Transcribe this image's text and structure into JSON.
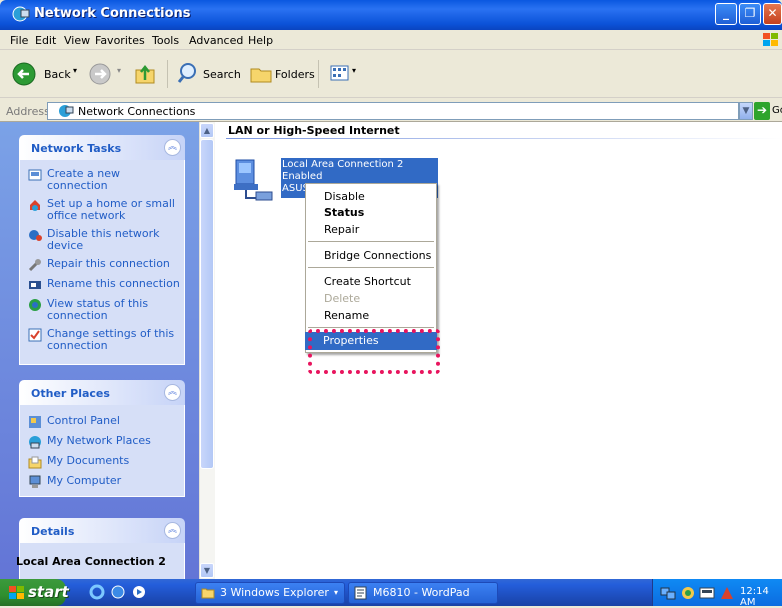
{
  "window": {
    "title": "Network Connections"
  },
  "menu": [
    "File",
    "Edit",
    "View",
    "Favorites",
    "Tools",
    "Advanced",
    "Help"
  ],
  "toolbar": {
    "back": "Back",
    "search": "Search",
    "folders": "Folders"
  },
  "address": {
    "label": "Address",
    "value": "Network Connections",
    "go": "Go"
  },
  "network_tasks": {
    "title": "Network Tasks",
    "items": [
      {
        "label": "Create a new connection",
        "icon": "new-connection-icon"
      },
      {
        "label": "Set up a home or small office network",
        "icon": "home-network-icon"
      },
      {
        "label": "Disable this network device",
        "icon": "disable-device-icon"
      },
      {
        "label": "Repair this connection",
        "icon": "repair-icon"
      },
      {
        "label": "Rename this connection",
        "icon": "rename-icon"
      },
      {
        "label": "View status of this connection",
        "icon": "status-icon"
      },
      {
        "label": "Change settings of this connection",
        "icon": "settings-icon"
      }
    ]
  },
  "other_places": {
    "title": "Other Places",
    "items": [
      {
        "label": "Control Panel",
        "icon": "control-panel-icon"
      },
      {
        "label": "My Network Places",
        "icon": "network-places-icon"
      },
      {
        "label": "My Documents",
        "icon": "documents-icon"
      },
      {
        "label": "My Computer",
        "icon": "computer-icon"
      }
    ]
  },
  "details": {
    "title": "Details",
    "name": "Local Area Connection 2"
  },
  "content": {
    "group": "LAN or High-Speed Internet",
    "connection": {
      "name": "Local Area Connection 2",
      "status": "Enabled",
      "device": "ASUS"
    }
  },
  "context_menu": {
    "disable": "Disable",
    "status": "Status",
    "repair": "Repair",
    "bridge": "Bridge Connections",
    "shortcut": "Create Shortcut",
    "delete": "Delete",
    "rename": "Rename",
    "properties": "Properties"
  },
  "taskbar": {
    "start": "start",
    "explorer": "3 Windows Explorer",
    "wordpad": "M6810 - WordPad",
    "clock": "12:14 AM"
  },
  "colors": {
    "highlight": "#316ac5",
    "annotation": "#e8155e",
    "link": "#215dc6"
  }
}
